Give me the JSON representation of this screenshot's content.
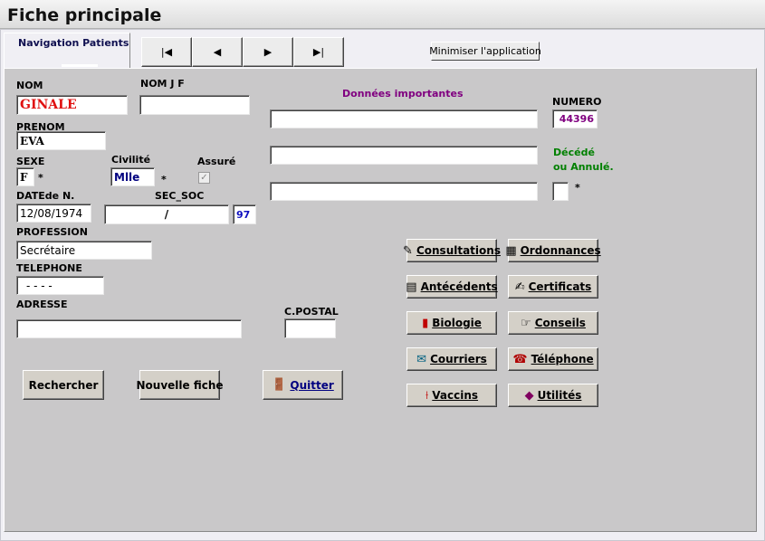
{
  "window": {
    "title": "Fiche principale"
  },
  "nav": {
    "tab_label": "Navigation Patients",
    "first": "|◀",
    "prev": "◀",
    "next": "▶",
    "last": "▶|",
    "minimize_label": "Minimiser l'application"
  },
  "patient": {
    "nom_label": "NOM",
    "nom": "GINALE",
    "nomjf_label": "NOM J F",
    "nomjf": "",
    "prenom_label": "PRENOM",
    "prenom": "EVA",
    "sexe_label": "SEXE",
    "sexe": "F",
    "sexe_star": "*",
    "civilite_label": "Civilité",
    "civilite": "Mlle",
    "civilite_star": "*",
    "assure_label": "Assuré",
    "assure_check": "✓",
    "date_label": "DATEde N.",
    "date": "12/08/1974",
    "secsoc_label": "SEC_SOC",
    "secsoc": "/",
    "secsoc_key": "97",
    "profession_label": "PROFESSION",
    "profession": "Secrétaire",
    "telephone_label": "TELEPHONE",
    "telephone": "- - - -",
    "adresse_label": "ADRESSE",
    "adresse": "",
    "cpostal_label": "C.POSTAL",
    "cpostal": ""
  },
  "important": {
    "label": "Données importantes",
    "line1": "",
    "line2": "",
    "line3": "",
    "numero_label": "NUMERO",
    "numero": "44396",
    "decede_label1": "Décédé",
    "decede_label2": "ou Annulé.",
    "decede_value": "",
    "decede_star": "*"
  },
  "actions": {
    "rechercher": "Rechercher",
    "nouvelle_fiche": "Nouvelle fiche",
    "quitter": "Quitter"
  },
  "modules": {
    "consultations": "Consultations",
    "ordonnances": "Ordonnances",
    "antecedents": "Antécédents",
    "certificats": "Certificats",
    "biologie": "Biologie",
    "conseils": "Conseils",
    "courriers": "Courriers",
    "telephone": "Téléphone",
    "vaccins": "Vaccins",
    "utilites": "Utilités"
  },
  "colors": {
    "panel_bg": "#c9c8c9",
    "important_label": "#800080",
    "decede_label": "#008000",
    "nom_value": "#e01010",
    "numero_value": "#800080",
    "secsoc_key": "#1010c0",
    "civilite_value": "#000080",
    "tab_label": "#101050"
  }
}
